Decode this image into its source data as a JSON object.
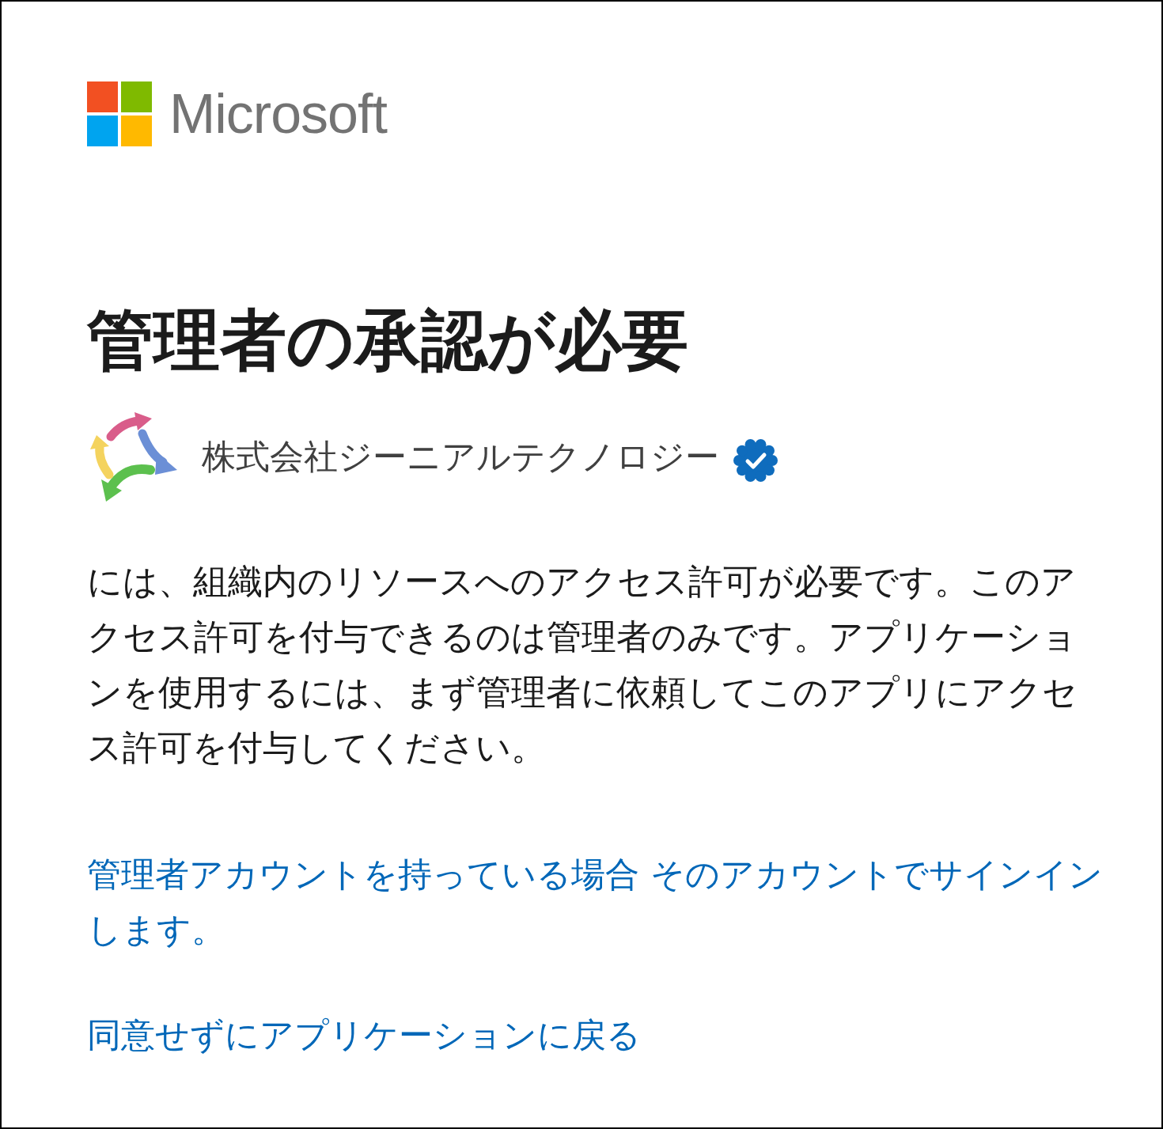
{
  "brand": {
    "name": "Microsoft"
  },
  "title": "管理者の承認が必要",
  "app": {
    "name": "株式会社ジーニアルテクノロジー",
    "verified": true
  },
  "message": "には、組織内のリソースへのアクセス許可が必要です。このアクセス許可を付与できるのは管理者のみです。アプリケーションを使用するには、まず管理者に依頼してこのアプリにアクセス許可を付与してください。",
  "links": [
    "管理者アカウントを持っている場合 そのアカウントでサインインします。",
    "同意せずにアプリケーションに戻る"
  ]
}
